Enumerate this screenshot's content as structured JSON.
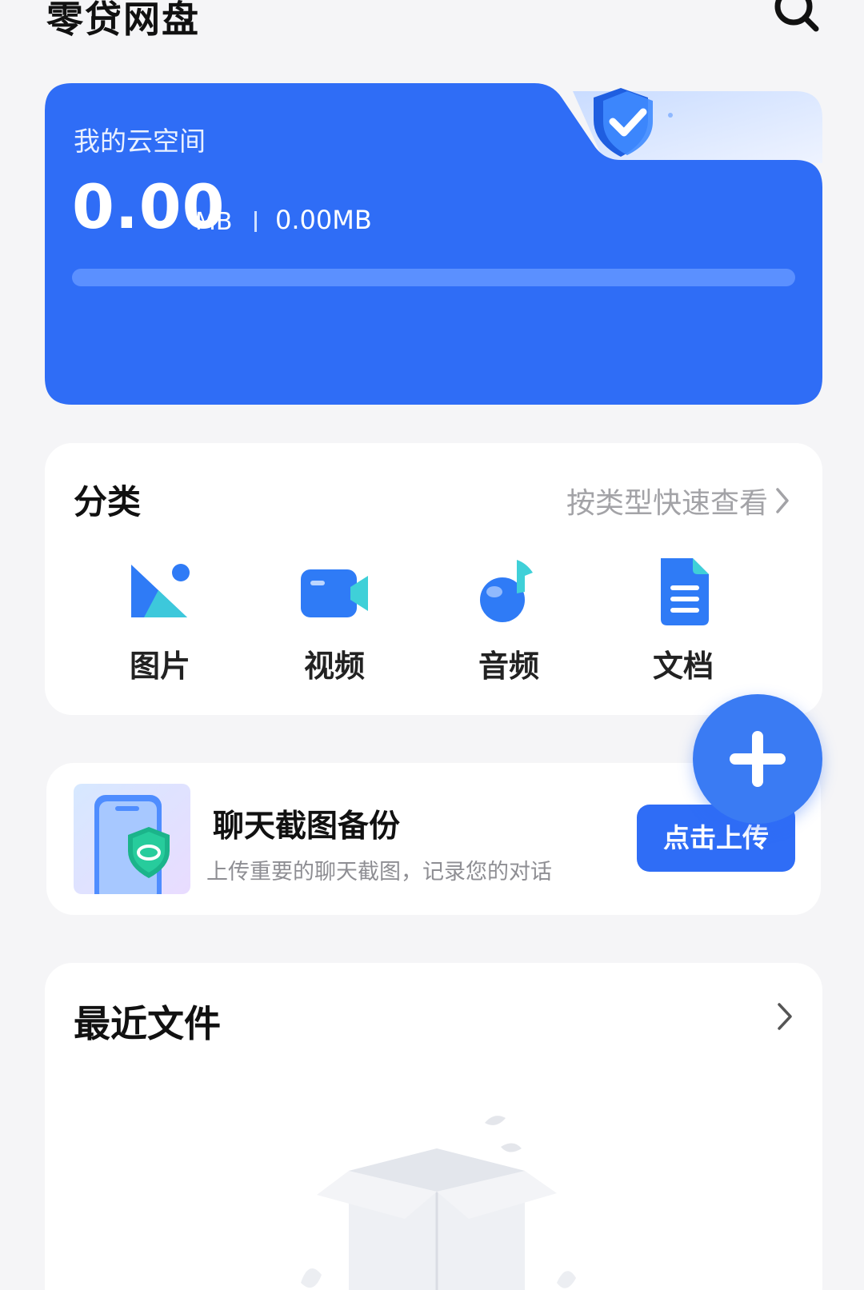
{
  "app": {
    "title": "零贷网盘"
  },
  "storage": {
    "label": "我的云空间",
    "used_value": "0.00",
    "used_unit": "MB",
    "total": "0.00MB",
    "progress_fraction": 0.0,
    "accent": "#2f6df6"
  },
  "categories": {
    "title": "分类",
    "more_label": "按类型快速查看",
    "items": [
      {
        "label": "图片",
        "icon": "image-icon"
      },
      {
        "label": "视频",
        "icon": "video-icon"
      },
      {
        "label": "音频",
        "icon": "audio-icon"
      },
      {
        "label": "文档",
        "icon": "document-icon"
      }
    ]
  },
  "backup": {
    "title": "聊天截图备份",
    "subtitle": "上传重要的聊天截图，记录您的对话",
    "button_label": "点击上传"
  },
  "recent": {
    "title": "最近文件"
  }
}
